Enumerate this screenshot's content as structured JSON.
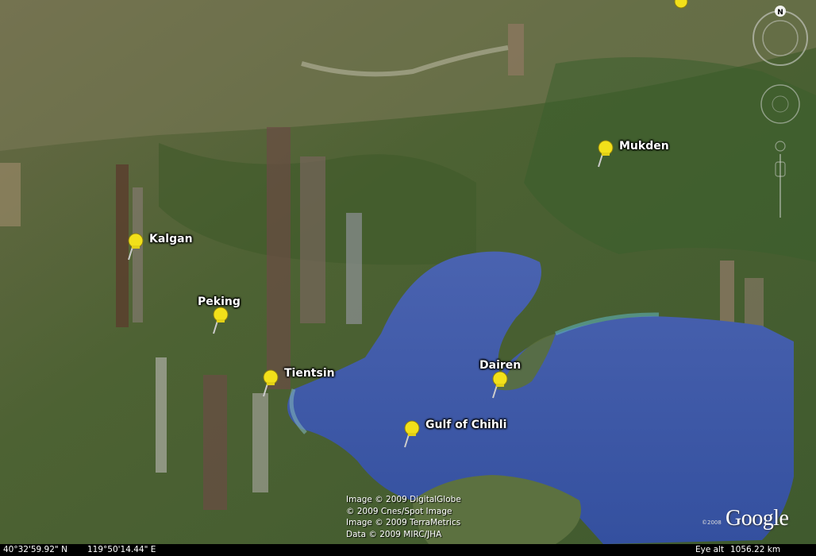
{
  "placemarks": [
    {
      "id": "mukden",
      "label": "Mukden"
    },
    {
      "id": "kalgan",
      "label": "Kalgan"
    },
    {
      "id": "peking",
      "label": "Peking"
    },
    {
      "id": "tientsin",
      "label": "Tientsin"
    },
    {
      "id": "dairen",
      "label": "Dairen"
    },
    {
      "id": "gulf",
      "label": "Gulf of Chihli"
    }
  ],
  "credits": [
    "Image © 2009 DigitalGlobe",
    "© 2009 Cnes/Spot Image",
    "Image © 2009 TerraMetrics",
    "Data © 2009 MIRC/JHA"
  ],
  "logo": {
    "text": "Google",
    "copyright": "©2008"
  },
  "status": {
    "latitude": "40°32'59.92\" N",
    "longitude": "119°50'14.44\" E",
    "eye_alt_label": "Eye alt",
    "eye_alt_value": "1056.22 km"
  },
  "nav": {
    "north_label": "N"
  },
  "colors": {
    "sea": "#3d5aa8",
    "land": "#4f6436",
    "pin": "#f2e01a"
  }
}
